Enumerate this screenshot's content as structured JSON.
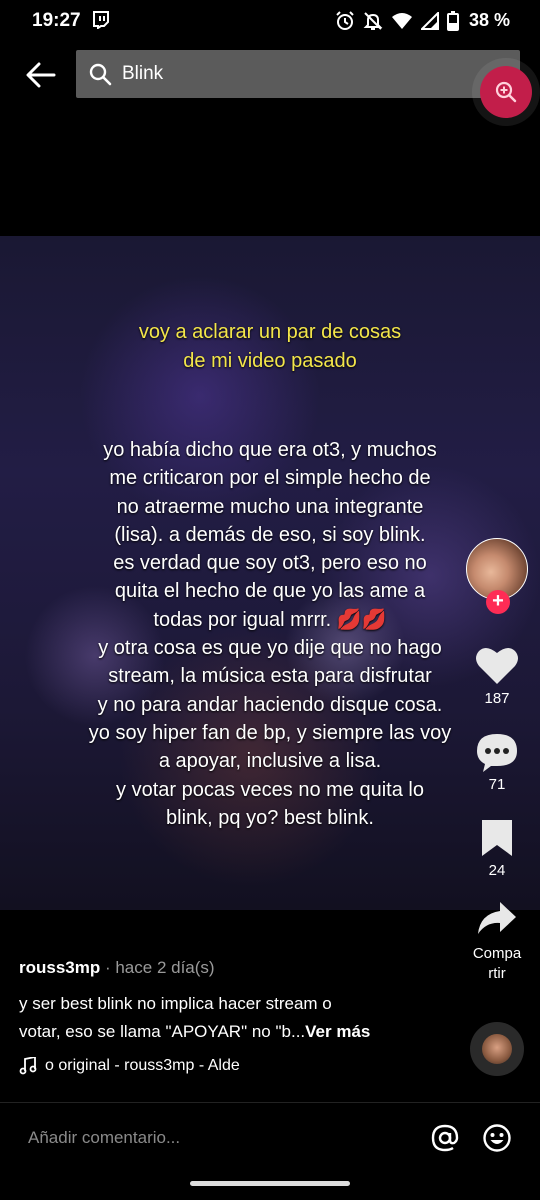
{
  "status_bar": {
    "time": "19:27",
    "battery": "38 %"
  },
  "search": {
    "value": "Blink"
  },
  "video": {
    "caption_title": [
      "voy a aclarar un par de cosas",
      "de mi video pasado"
    ],
    "caption_body": [
      "yo había dicho que era ot3, y muchos",
      "me criticaron por el simple hecho de",
      "no atraerme mucho una integrante",
      "(lisa). a demás de eso, si soy blink.",
      "es verdad que soy ot3, pero eso no",
      "quita el hecho de que yo las ame a",
      "todas por igual mrrr. 💋💋",
      "y otra cosa es que yo dije que no hago",
      "stream, la música esta para disfrutar",
      "y no para andar haciendo disque cosa.",
      "yo soy hiper fan de bp, y siempre las voy",
      "a apoyar, inclusive a lisa.",
      "y votar pocas veces no me quita lo",
      "blink, pq yo? best blink."
    ]
  },
  "actions": {
    "likes": "187",
    "comments": "71",
    "saves": "24",
    "share_label": [
      "Compa",
      "rtir"
    ]
  },
  "post": {
    "author": "rouss3mp",
    "time": " · hace 2 día(s)",
    "description_1": "y ser best blink no implica hacer stream o",
    "description_2": "votar, eso se llama \"APOYAR\" no \"b...",
    "see_more": "Ver más",
    "sound": "o original - rouss3mp - Alde"
  },
  "comment_bar": {
    "placeholder": "Añadir comentario..."
  },
  "colors": {
    "accent": "#fe2c55",
    "zoom_button": "#c21e4a",
    "caption_yellow": "#f3e64a"
  }
}
